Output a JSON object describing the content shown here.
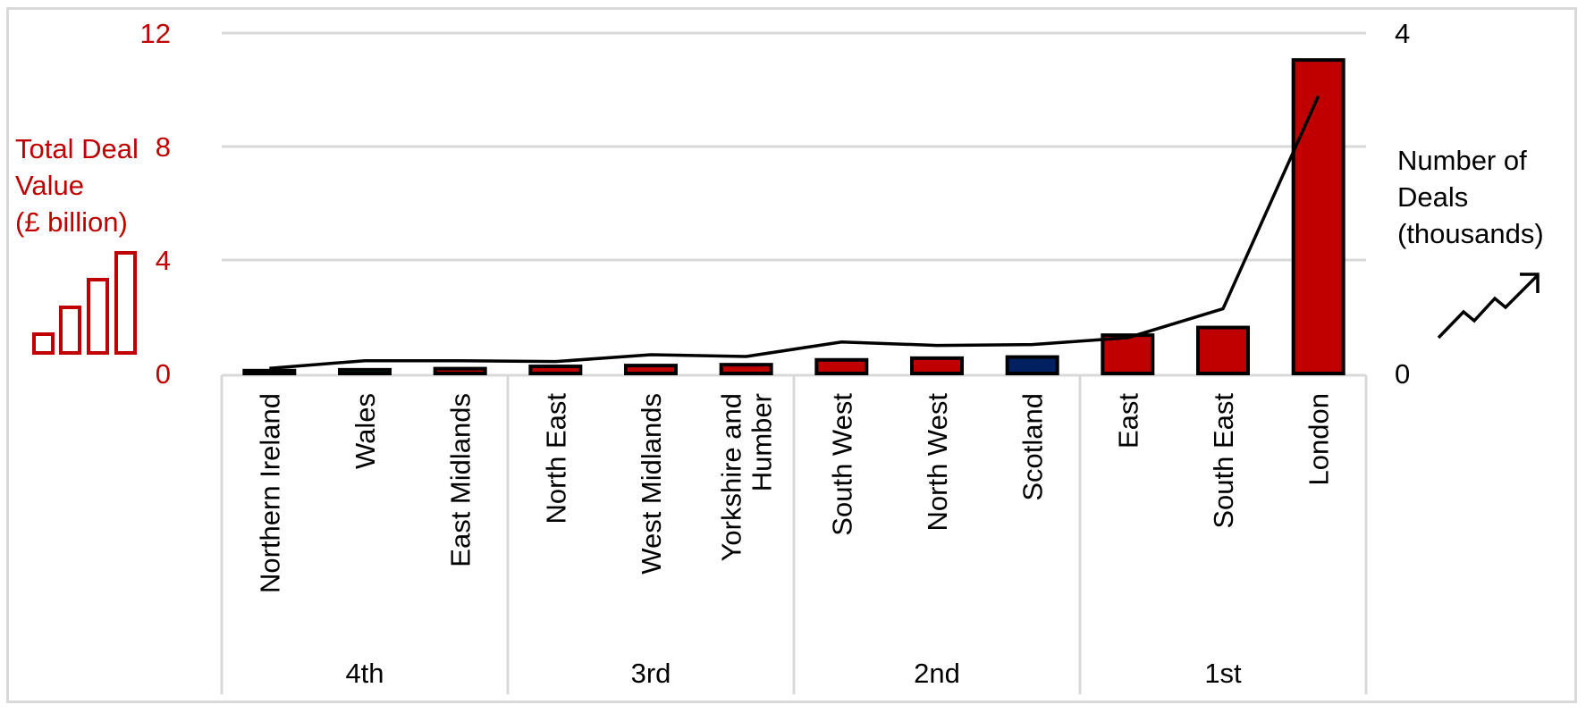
{
  "chart_data": {
    "type": "bar",
    "title": "",
    "categories": [
      "Northern Ireland",
      "Wales",
      "East Midlands",
      "North East",
      "West Midlands",
      "Yorkshire and Humber",
      "South West",
      "North West",
      "Scotland",
      "East",
      "South East",
      "London"
    ],
    "category_label_lines": [
      [
        "Northern Ireland"
      ],
      [
        "Wales"
      ],
      [
        "East Midlands"
      ],
      [
        "North East"
      ],
      [
        "West Midlands"
      ],
      [
        "Yorkshire and",
        "Humber"
      ],
      [
        "South West"
      ],
      [
        "North West"
      ],
      [
        "Scotland"
      ],
      [
        "East"
      ],
      [
        "South East"
      ],
      [
        "London"
      ]
    ],
    "groups": [
      {
        "label": "4th",
        "count": 3
      },
      {
        "label": "3rd",
        "count": 3
      },
      {
        "label": "2nd",
        "count": 3
      },
      {
        "label": "1st",
        "count": 3
      }
    ],
    "series": [
      {
        "name": "Total Deal Value (£ billion)",
        "type": "bar",
        "axis": "left",
        "values": [
          0.1,
          0.13,
          0.17,
          0.25,
          0.28,
          0.31,
          0.48,
          0.54,
          0.58,
          1.35,
          1.62,
          11.05
        ],
        "colors": [
          "#c00000",
          "#00a050",
          "#c00000",
          "#c00000",
          "#c00000",
          "#c00000",
          "#c00000",
          "#c00000",
          "#002060",
          "#c00000",
          "#c00000",
          "#c00000"
        ]
      },
      {
        "name": "Number of Deals (thousands)",
        "type": "line",
        "axis": "right",
        "values": [
          0.06,
          0.15,
          0.15,
          0.14,
          0.22,
          0.2,
          0.37,
          0.33,
          0.34,
          0.42,
          0.76,
          3.26
        ],
        "color": "#000000"
      }
    ],
    "y_left": {
      "label_lines": [
        "Total Deal",
        "Value",
        "(£ billion)"
      ],
      "ylim": [
        0,
        12
      ],
      "ticks": [
        "0",
        "4",
        "8",
        "12"
      ],
      "tick_values": [
        0,
        4,
        8,
        12
      ],
      "color": "#c00000"
    },
    "y_right": {
      "label_lines": [
        "Number of",
        "Deals",
        "(thousands)"
      ],
      "ylim": [
        0,
        4
      ],
      "ticks": [
        "0",
        "4"
      ],
      "tick_values": [
        0,
        4
      ],
      "color": "#000000"
    },
    "xlabel": "",
    "grid": true,
    "legend": "none",
    "icons": {
      "left": "bar-chart-icon",
      "right": "trend-up-arrow-icon"
    }
  }
}
